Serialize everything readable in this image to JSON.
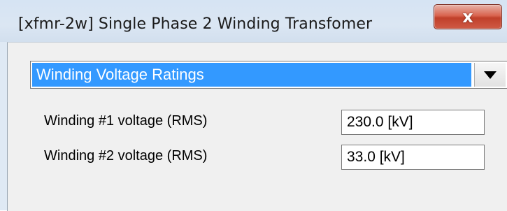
{
  "window": {
    "title": "[xfmr-2w] Single Phase 2 Winding Transfomer",
    "close_icon": "close-icon",
    "close_label": "x"
  },
  "category_select": {
    "selected": "Winding Voltage Ratings",
    "icon": "chevron-down-icon"
  },
  "fields": [
    {
      "label": "Winding #1 voltage (RMS)",
      "value": "230.0 [kV]"
    },
    {
      "label": "Winding #2 voltage (RMS)",
      "value": "33.0 [kV]"
    }
  ],
  "colors": {
    "selection": "#3399ff",
    "client_background": "#f0f0f0",
    "titlebar": "#dbe6f3",
    "close_button": "#d9644f"
  }
}
